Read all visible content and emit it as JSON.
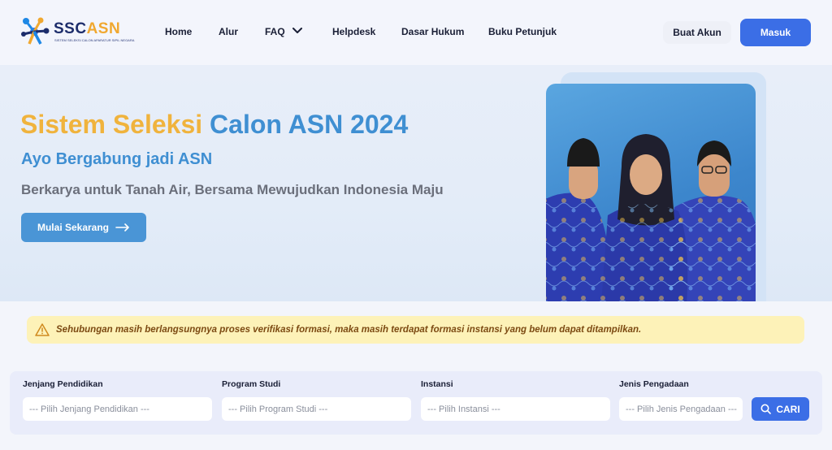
{
  "header": {
    "logo": {
      "brand_main": "SSC",
      "brand_accent": "ASN",
      "tagline": "SISTEM SELEKSI CALON APARATUR SIPIL NEGARA"
    },
    "nav": [
      {
        "label": "Home"
      },
      {
        "label": "Alur"
      },
      {
        "label": "FAQ"
      },
      {
        "label": "Helpdesk"
      },
      {
        "label": "Dasar Hukum"
      },
      {
        "label": "Buku Petunjuk"
      }
    ],
    "register_label": "Buat Akun",
    "login_label": "Masuk"
  },
  "hero": {
    "title_part1": "Sistem Seleksi",
    "title_part2": "Calon ASN 2024",
    "subtitle": "Ayo Bergabung jadi ASN",
    "tagline": "Berkarya untuk Tanah Air, Bersama Mewujudkan Indonesia Maju",
    "cta_label": "Mulai Sekarang"
  },
  "alert": {
    "text": "Sehubungan masih berlangsungnya proses verifikasi formasi, maka masih terdapat formasi instansi yang belum dapat ditampilkan."
  },
  "filters": [
    {
      "label": "Jenjang Pendidikan",
      "placeholder": "--- Pilih Jenjang Pendidikan ---"
    },
    {
      "label": "Program Studi",
      "placeholder": "--- Pilih Program Studi ---"
    },
    {
      "label": "Instansi",
      "placeholder": "--- Pilih Instansi ---"
    },
    {
      "label": "Jenis Pengadaan",
      "placeholder": "--- Pilih Jenis Pengadaan ---"
    }
  ],
  "search_label": "CARI",
  "colors": {
    "primary": "#3b6ee6",
    "accent_gold": "#f0b33d",
    "accent_blue": "#3f8fd2",
    "alert_bg": "#fdf2b8"
  },
  "icons": [
    "logo-icon",
    "chevron-down-icon",
    "arrow-right-icon",
    "warning-icon",
    "search-icon"
  ]
}
